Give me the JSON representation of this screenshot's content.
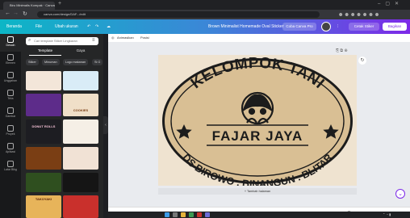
{
  "browser": {
    "tab_title": "Biru Minimalis Kompak · Canva",
    "url": "canva.com/design/DAF.../edit"
  },
  "header": {
    "home": "Beranda",
    "file": "File",
    "resize": "Ubah ukuran",
    "doc_title": "Brown Minimalist Homemade Oval Sticker",
    "try_pro": "Coba Canva Pro",
    "present": "Cetak Stiker",
    "share": "Bagikan"
  },
  "rail": [
    {
      "label": "Desain",
      "icon": "template-icon"
    },
    {
      "label": "Elemen",
      "icon": "shapes-icon"
    },
    {
      "label": "Unggahan",
      "icon": "upload-icon"
    },
    {
      "label": "Teks",
      "icon": "text-icon"
    },
    {
      "label": "Gambar",
      "icon": "draw-icon"
    },
    {
      "label": "Proyek",
      "icon": "folder-icon"
    },
    {
      "label": "Aplikasi",
      "icon": "apps-icon"
    },
    {
      "label": "Latar Blkg",
      "icon": "background-icon"
    }
  ],
  "panel": {
    "search_placeholder": "Cari template Stiker Lingkaran",
    "tabs": [
      "Template",
      "Gaya"
    ],
    "chips": [
      "Stiker",
      "Minuman",
      "Logo makanan",
      "Si G"
    ],
    "thumbs": [
      {
        "text": "",
        "bg": "#f3e6d9"
      },
      {
        "text": "",
        "bg": "#d9ecf7"
      },
      {
        "text": "",
        "bg": "#5d2c8a"
      },
      {
        "text": "COOKIES",
        "bg": "#f0dfc8"
      },
      {
        "text": "DONUT ROLLS",
        "bg": "#1d1d22"
      },
      {
        "text": "",
        "bg": "#f5efe6"
      },
      {
        "text": "",
        "bg": "#7a3e14"
      },
      {
        "text": "",
        "bg": "#f1e2d5"
      },
      {
        "text": "",
        "bg": "#2f4f1f"
      },
      {
        "text": "",
        "bg": "#151515"
      },
      {
        "text": "TAKOYAKI",
        "bg": "#e7b45a"
      },
      {
        "text": "",
        "bg": "#c9302c"
      }
    ]
  },
  "workspace": {
    "toolbar_animate": "Animasikan",
    "toolbar_position": "Posisi",
    "add_page": "+ Tambah halaman",
    "notes": "Catatan",
    "page_indicator": "Halaman 1 / 1",
    "zoom": "146%",
    "zoom_fraction": 0.68
  },
  "sticker": {
    "line1": "KELOMPOK TANI",
    "line2": "FAJAR JAYA",
    "line3": "DS BIROWO . BINANGUN . BLITAR",
    "colors": {
      "fill": "#d9bf94",
      "ink": "#1c1c1c",
      "page": "#efe3d0"
    }
  }
}
